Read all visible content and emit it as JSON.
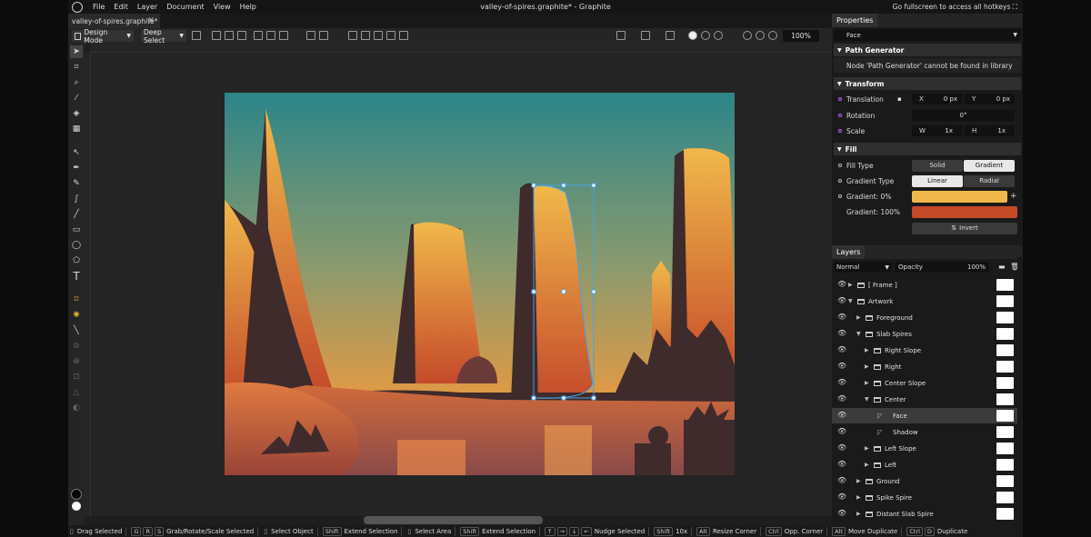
{
  "menubar": {
    "items": [
      "File",
      "Edit",
      "Layer",
      "Document",
      "View",
      "Help"
    ],
    "title": "valley-of-spires.graphite* - Graphite",
    "hotkeys_hint": "Go fullscreen to access all hotkeys"
  },
  "tab": {
    "label": "valley-of-spires.graphite*",
    "close": "✕"
  },
  "toolbar": {
    "mode": "Design Mode",
    "select": "Deep Select",
    "zoom": "100%"
  },
  "properties": {
    "tab": "Properties",
    "layer_name": "Face",
    "path_generator": {
      "title": "Path Generator",
      "message": "Node 'Path Generator' cannot be found in library"
    },
    "transform": {
      "title": "Transform",
      "translation": "Translation",
      "x_label": "X",
      "x_value": "0 px",
      "y_label": "Y",
      "y_value": "0 px",
      "rotation": "Rotation",
      "rotation_value": "0°",
      "scale": "Scale",
      "w_label": "W",
      "w_value": "1x",
      "h_label": "H",
      "h_value": "1x"
    },
    "fill": {
      "title": "Fill",
      "fill_type": "Fill Type",
      "solid": "Solid",
      "gradient": "Gradient",
      "gradient_type": "Gradient Type",
      "linear": "Linear",
      "radial": "Radial",
      "g0": "Gradient: 0%",
      "g100": "Gradient: 100%",
      "color0": "#f0b84a",
      "color100": "#c44a2a",
      "invert": "Invert"
    }
  },
  "layers": {
    "tab": "Layers",
    "blend": "Normal",
    "opacity_label": "Opacity",
    "opacity": "100%",
    "rows": [
      {
        "name": "[ Frame ]",
        "depth": 0,
        "open": false
      },
      {
        "name": "Artwork",
        "depth": 0,
        "open": true
      },
      {
        "name": "Foreground",
        "depth": 1,
        "open": false
      },
      {
        "name": "Slab Spires",
        "depth": 1,
        "open": true
      },
      {
        "name": "Right Slope",
        "depth": 2,
        "open": false
      },
      {
        "name": "Right",
        "depth": 2,
        "open": false
      },
      {
        "name": "Center Slope",
        "depth": 2,
        "open": false
      },
      {
        "name": "Center",
        "depth": 2,
        "open": true
      },
      {
        "name": "Face",
        "depth": 3,
        "open": false,
        "leaf": true,
        "selected": true
      },
      {
        "name": "Shadow",
        "depth": 3,
        "open": false,
        "leaf": true
      },
      {
        "name": "Left Slope",
        "depth": 2,
        "open": false
      },
      {
        "name": "Left",
        "depth": 2,
        "open": false
      },
      {
        "name": "Ground",
        "depth": 1,
        "open": false
      },
      {
        "name": "Spike Spire",
        "depth": 1,
        "open": false
      },
      {
        "name": "Distant Slab Spire",
        "depth": 1,
        "open": false
      }
    ]
  },
  "status": [
    {
      "keys": [],
      "label": "Drag Selected"
    },
    {
      "keys": [
        "G",
        "R",
        "S"
      ],
      "label": "Grab/Rotate/Scale Selected"
    },
    {
      "keys": [],
      "label": "Select Object"
    },
    {
      "keys": [
        "Shift"
      ],
      "label": "Extend Selection"
    },
    {
      "keys": [],
      "label": "Select Area"
    },
    {
      "keys": [
        "Shift"
      ],
      "label": "Extend Selection"
    },
    {
      "keys": [
        "↑",
        "→",
        "↓",
        "←"
      ],
      "label": "Nudge Selected"
    },
    {
      "keys": [
        "Shift"
      ],
      "label": "10x"
    },
    {
      "keys": [
        "Alt"
      ],
      "label": "Resize Corner"
    },
    {
      "keys": [
        "Ctrl"
      ],
      "label": "Opp. Corner"
    },
    {
      "keys": [
        "Alt"
      ],
      "label": "Move Duplicate"
    },
    {
      "keys": [
        "Ctrl",
        "D"
      ],
      "label": "Duplicate"
    }
  ]
}
